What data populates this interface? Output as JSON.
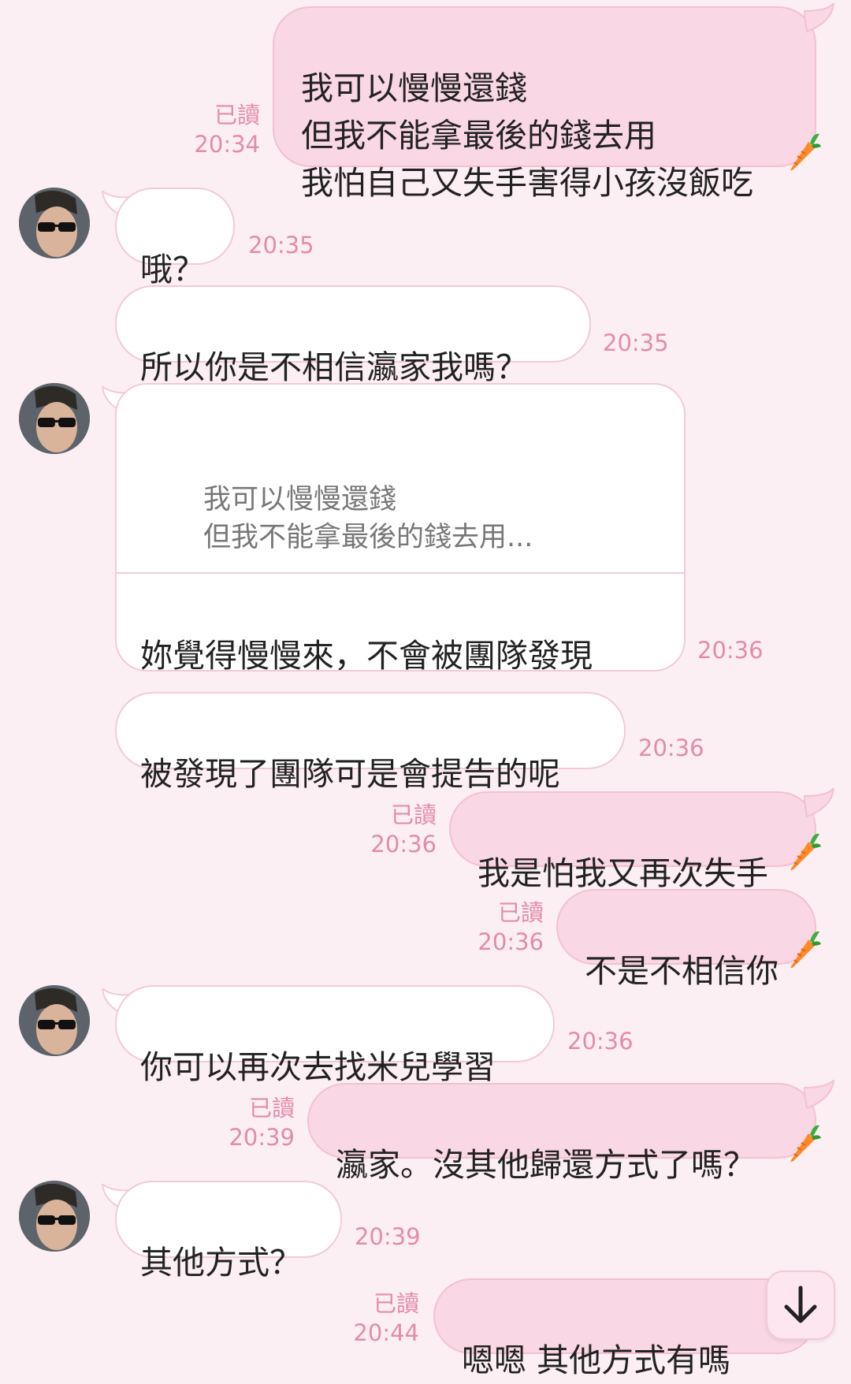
{
  "messages": [
    {
      "dir": "out",
      "text": "我可以慢慢還錢\n但我不能拿最後的錢去用\n我怕自己又失手害得小孩沒飯吃",
      "read": "已讀",
      "time": "20:34"
    },
    {
      "dir": "in",
      "text": "哦？",
      "time": "20:35"
    },
    {
      "dir": "in",
      "text": "所以你是不相信瀛家我嗎？",
      "time": "20:35"
    },
    {
      "dir": "in",
      "quote": "我可以慢慢還錢\n但我不能拿最後的錢去用...",
      "text": "妳覺得慢慢來，不會被團隊發現\n挪用嗎",
      "time": "20:36"
    },
    {
      "dir": "in",
      "text": "被發現了團隊可是會提告的呢",
      "time": "20:36"
    },
    {
      "dir": "out",
      "text": "我是怕我又再次失手",
      "read": "已讀",
      "time": "20:36"
    },
    {
      "dir": "out",
      "text": "不是不相信你",
      "read": "已讀",
      "time": "20:36"
    },
    {
      "dir": "in",
      "text": "你可以再次去找米兒學習",
      "time": "20:36"
    },
    {
      "dir": "out",
      "text": "瀛家。沒其他歸還方式了嗎？",
      "read": "已讀",
      "time": "20:39"
    },
    {
      "dir": "in",
      "text": "其他方式？",
      "time": "20:39"
    },
    {
      "dir": "out",
      "text": "嗯嗯  其他方式有嗎",
      "read": "已讀",
      "time": "20:44"
    }
  ],
  "icons": {
    "carrot": "carrot-sticker-icon",
    "scroll": "arrow-down-icon",
    "avatar": "contact-avatar"
  },
  "colors": {
    "background": "#fceff4",
    "outgoing_bubble": "#f9d7e4",
    "incoming_bubble": "#ffffff",
    "timestamp": "#e48bab"
  }
}
